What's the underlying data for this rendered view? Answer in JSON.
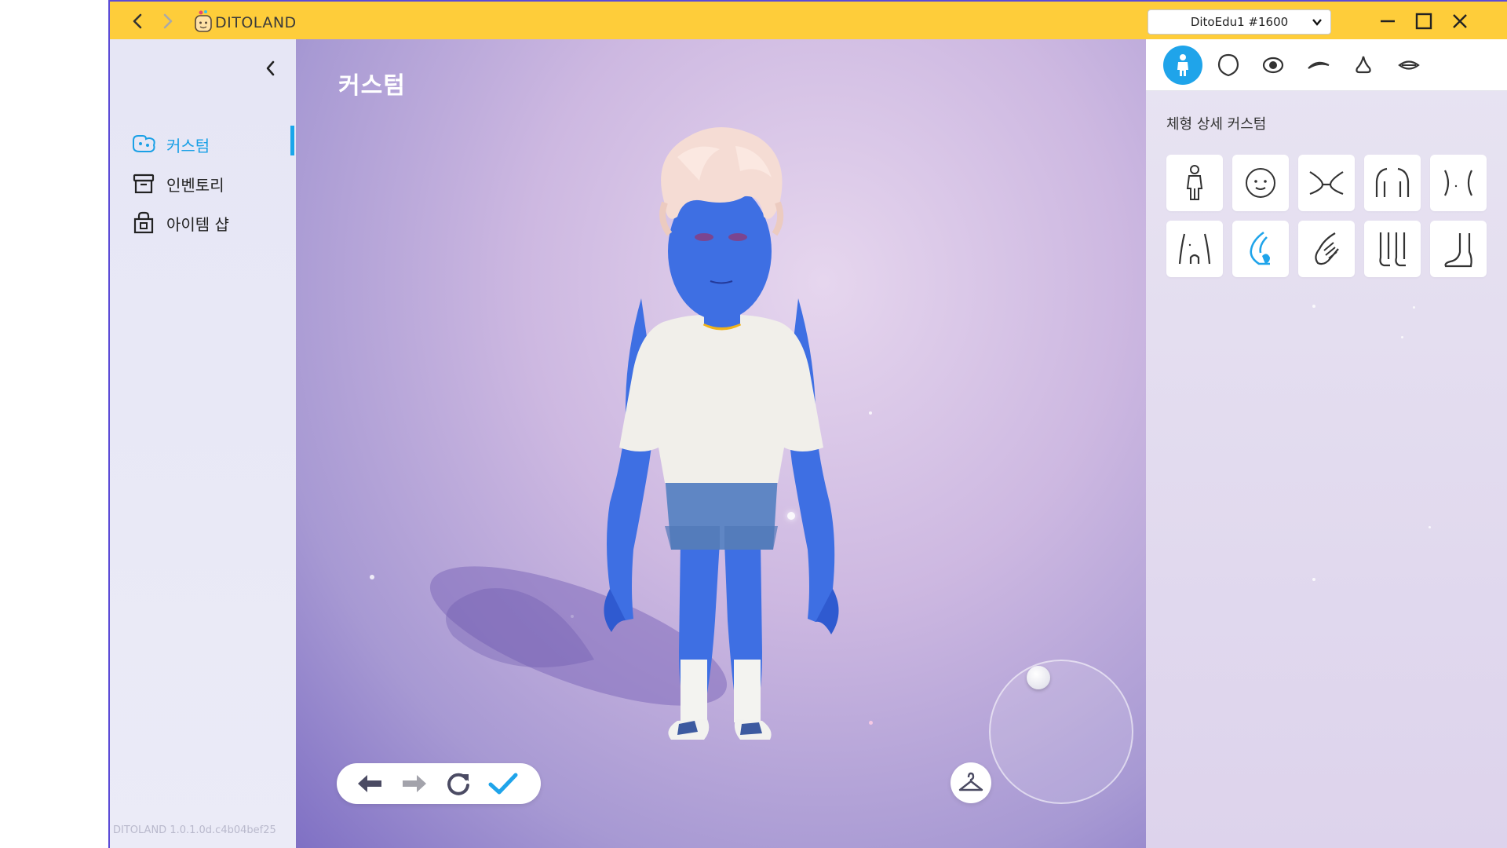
{
  "titlebar": {
    "app_title": "DITOLAND",
    "account_selected": "DitoEdu1 #1600",
    "colors": {
      "bar": "#fecd3a",
      "frame": "#5b4bd6"
    }
  },
  "sidebar": {
    "items": [
      {
        "label": "커스텀",
        "icon": "custom-icon",
        "active": true
      },
      {
        "label": "인벤토리",
        "icon": "inventory-box-icon",
        "active": false
      },
      {
        "label": "아이템 샵",
        "icon": "shopping-bag-icon",
        "active": false
      }
    ],
    "version": "DITOLAND 1.0.1.0d.c4b04bef25"
  },
  "main": {
    "title": "커스텀"
  },
  "right_panel": {
    "tabs": [
      {
        "icon": "body-figure-icon",
        "active": true
      },
      {
        "icon": "head-shape-icon",
        "active": false
      },
      {
        "icon": "eye-icon",
        "active": false
      },
      {
        "icon": "eyebrow-icon",
        "active": false
      },
      {
        "icon": "nose-icon",
        "active": false
      },
      {
        "icon": "mouth-icon",
        "active": false
      }
    ],
    "section_title": "체형 상세 커스텀",
    "parts": [
      {
        "icon": "full-body-icon",
        "selected": false
      },
      {
        "icon": "face-icon",
        "selected": false
      },
      {
        "icon": "neck-icon",
        "selected": false
      },
      {
        "icon": "shoulders-icon",
        "selected": false
      },
      {
        "icon": "chest-icon",
        "selected": false
      },
      {
        "icon": "waist-icon",
        "selected": false
      },
      {
        "icon": "arm-icon",
        "selected": true
      },
      {
        "icon": "hand-icon",
        "selected": false
      },
      {
        "icon": "legs-icon",
        "selected": false
      },
      {
        "icon": "foot-icon",
        "selected": false
      }
    ],
    "accent": "#1fa4ea"
  }
}
